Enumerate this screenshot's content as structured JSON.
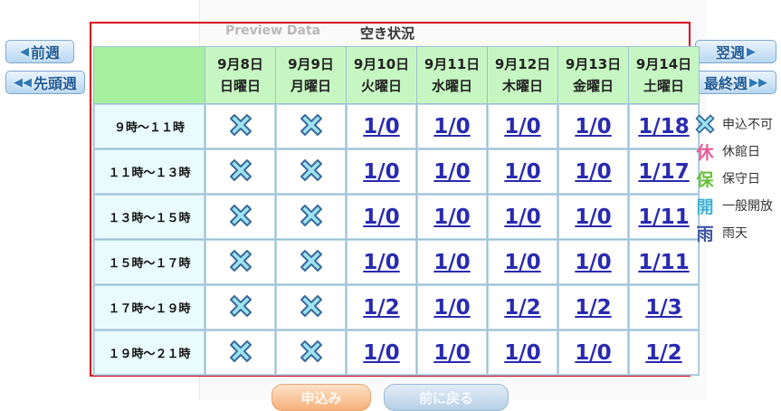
{
  "header": {
    "preview_label": "Preview Data",
    "title": "空き状況"
  },
  "nav": {
    "prev_week": "前週",
    "first_week": "先頭週",
    "next_week": "翌週",
    "last_week": "最終週"
  },
  "days": [
    {
      "date": "9月8日",
      "weekday": "日曜日"
    },
    {
      "date": "9月9日",
      "weekday": "月曜日"
    },
    {
      "date": "9月10日",
      "weekday": "火曜日"
    },
    {
      "date": "9月11日",
      "weekday": "水曜日"
    },
    {
      "date": "9月12日",
      "weekday": "木曜日"
    },
    {
      "date": "9月13日",
      "weekday": "金曜日"
    },
    {
      "date": "9月14日",
      "weekday": "土曜日"
    }
  ],
  "rows": [
    {
      "slot": "９時～１１時",
      "cells": [
        "x",
        "x",
        "1/0",
        "1/0",
        "1/0",
        "1/0",
        "1/18"
      ]
    },
    {
      "slot": "１１時～１３時",
      "cells": [
        "x",
        "x",
        "1/0",
        "1/0",
        "1/0",
        "1/0",
        "1/17"
      ]
    },
    {
      "slot": "１３時～１５時",
      "cells": [
        "x",
        "x",
        "1/0",
        "1/0",
        "1/0",
        "1/0",
        "1/11"
      ]
    },
    {
      "slot": "１５時～１７時",
      "cells": [
        "x",
        "x",
        "1/0",
        "1/0",
        "1/0",
        "1/0",
        "1/11"
      ]
    },
    {
      "slot": "１７時～１９時",
      "cells": [
        "x",
        "x",
        "1/2",
        "1/0",
        "1/2",
        "1/2",
        "1/3"
      ]
    },
    {
      "slot": "１９時～２１時",
      "cells": [
        "x",
        "x",
        "1/0",
        "1/0",
        "1/0",
        "1/0",
        "1/2"
      ]
    }
  ],
  "legend": [
    {
      "icon": "x-mark-icon",
      "glyph": "",
      "label": "申込不可"
    },
    {
      "icon": "closed-day-icon",
      "glyph": "休",
      "label": "休館日"
    },
    {
      "icon": "maintenance-day-icon",
      "glyph": "保",
      "label": "保守日"
    },
    {
      "icon": "public-open-icon",
      "glyph": "開",
      "label": "一般開放"
    },
    {
      "icon": "rain-icon",
      "glyph": "雨",
      "label": "雨天"
    }
  ],
  "bottom": {
    "apply_label": "申込み",
    "back_label": "前に戻る"
  },
  "colors": {
    "frame_border": "#d9001b",
    "header_green": "#c6f7c2",
    "slot_bg": "#e9fbfd",
    "link_blue": "#2a2ab0",
    "x_fill": "#9ee3f0",
    "x_stroke": "#3a6b9c"
  }
}
